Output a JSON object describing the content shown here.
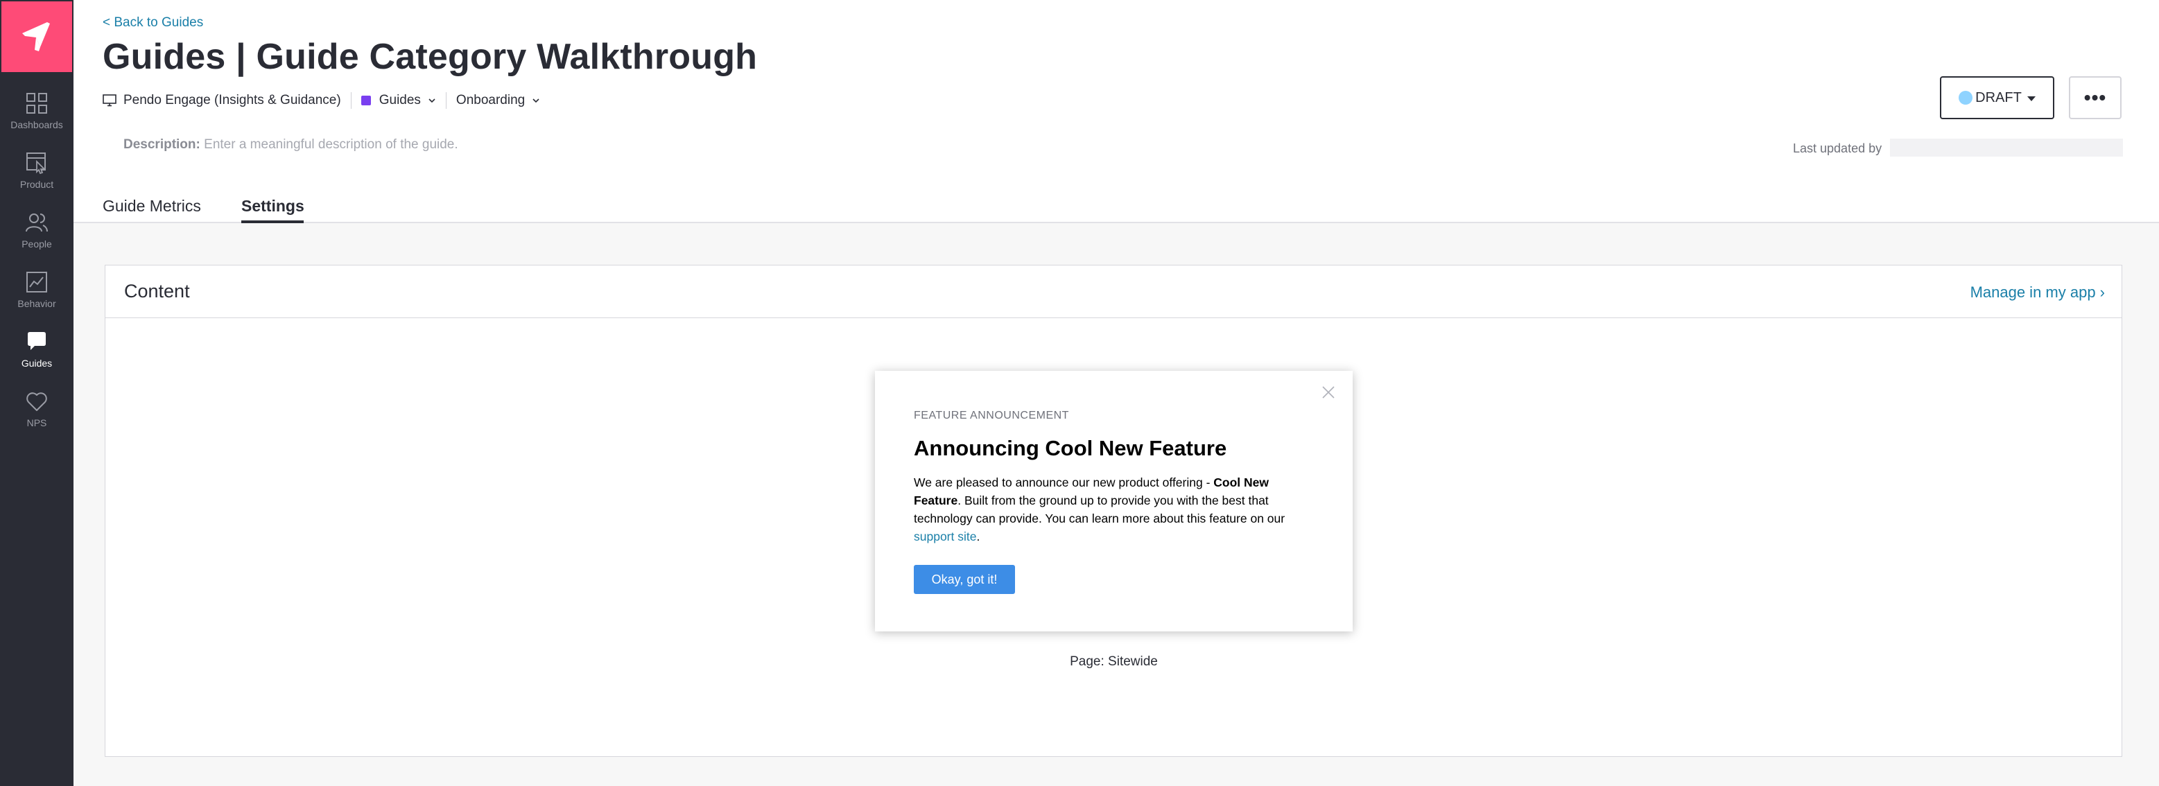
{
  "sidebar": {
    "logo": "pendo-logo-icon",
    "items": [
      {
        "label": "Dashboards",
        "icon": "dashboards-grid-icon",
        "active": false
      },
      {
        "label": "Product",
        "icon": "product-cursor-icon",
        "active": false
      },
      {
        "label": "People",
        "icon": "people-icon",
        "active": false
      },
      {
        "label": "Behavior",
        "icon": "behavior-chart-icon",
        "active": false
      },
      {
        "label": "Guides",
        "icon": "guides-chat-icon",
        "active": true
      },
      {
        "label": "NPS",
        "icon": "nps-heart-icon",
        "active": false
      }
    ]
  },
  "header": {
    "back_link": "< Back to Guides",
    "title": "Guides | Guide Category Walkthrough",
    "app_name": "Pendo Engage (Insights & Guidance)",
    "category": "Guides",
    "segment": "Onboarding",
    "status": "DRAFT",
    "more_label": "•••",
    "description_label": "Description:",
    "description_placeholder": "Enter a meaningful description of the guide.",
    "last_updated_label": "Last updated by"
  },
  "tabs": [
    {
      "label": "Guide Metrics",
      "active": false
    },
    {
      "label": "Settings",
      "active": true
    }
  ],
  "content": {
    "title": "Content",
    "manage_link": "Manage in my app ›",
    "page_label": "Page: Sitewide"
  },
  "guide": {
    "eyebrow": "FEATURE ANNOUNCEMENT",
    "heading": "Announcing Cool New Feature",
    "body_1": "We are pleased to announce our new product offering - ",
    "body_bold": "Cool New Feature",
    "body_2": ". Built from the ground up to provide you with the best that technology can provide. You can learn more about this feature on our ",
    "body_link": "support site",
    "body_3": ".",
    "button": "Okay, got it!"
  },
  "colors": {
    "sidebar_bg": "#2a2c35",
    "brand_pink": "#fe4b77",
    "link_blue": "#1a7fa8",
    "guide_button": "#3d8de6",
    "category_purple": "#7a3ff0",
    "draft_dot": "#8fd3ff"
  }
}
